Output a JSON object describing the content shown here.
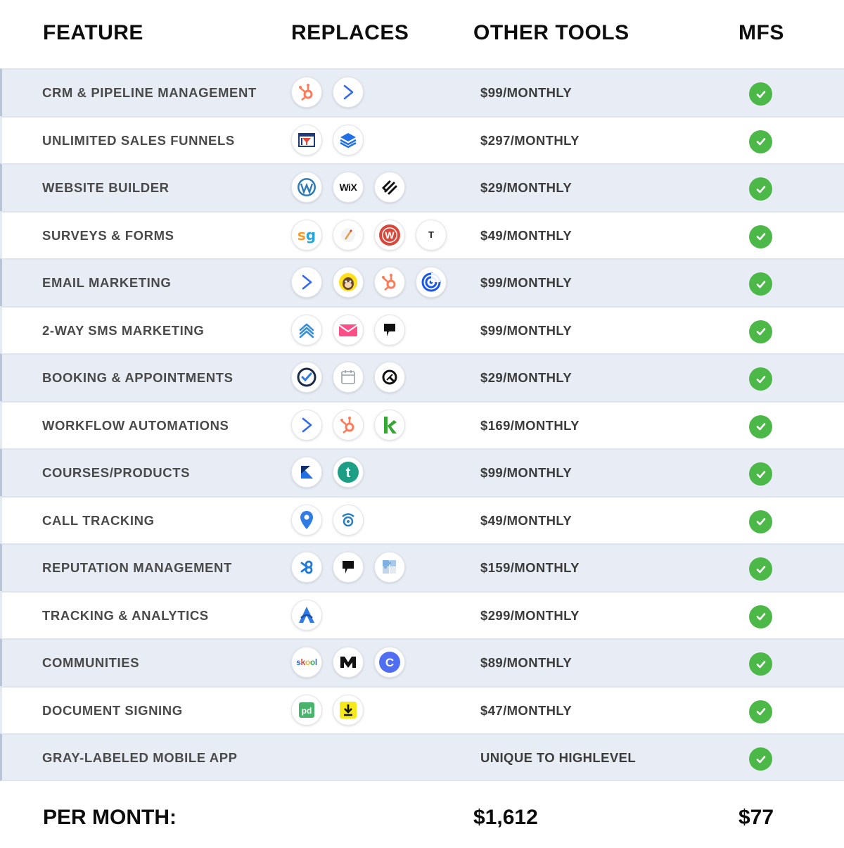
{
  "header": {
    "feature": "FEATURE",
    "replaces": "REPLACES",
    "other_tools": "OTHER TOOLS",
    "mfs": "MFS"
  },
  "colors": {
    "row_shade": "#e7ecf5",
    "check_green": "#4cb848",
    "hubspot_orange": "#ff7a59"
  },
  "rows": [
    {
      "feature": "CRM & PIPELINE MANAGEMENT",
      "price": "$99/MONTHLY",
      "icons": [
        "hubspot-icon",
        "activecampaign-icon"
      ],
      "mfs": "check-icon"
    },
    {
      "feature": "UNLIMITED SALES FUNNELS",
      "price": "$297/MONTHLY",
      "icons": [
        "clickfunnels-icon",
        "layers-icon"
      ],
      "mfs": "check-icon"
    },
    {
      "feature": "WEBSITE BUILDER",
      "price": "$29/MONTHLY",
      "icons": [
        "wordpress-icon",
        "wix-icon",
        "squarespace-icon"
      ],
      "mfs": "check-icon"
    },
    {
      "feature": "SURVEYS & FORMS",
      "price": "$49/MONTHLY",
      "icons": [
        "surveygizmo-icon",
        "pencil-icon",
        "wufoo-icon",
        "typeform-icon"
      ],
      "mfs": "check-icon"
    },
    {
      "feature": "EMAIL MARKETING",
      "price": "$99/MONTHLY",
      "icons": [
        "activecampaign-icon",
        "mailchimp-icon",
        "hubspot-icon",
        "constantcontact-icon"
      ],
      "mfs": "check-icon"
    },
    {
      "feature": "2-WAY SMS MARKETING",
      "price": "$99/MONTHLY",
      "icons": [
        "wave-icon",
        "envelope-icon",
        "podium-icon"
      ],
      "mfs": "check-icon"
    },
    {
      "feature": "BOOKING & APPOINTMENTS",
      "price": "$29/MONTHLY",
      "icons": [
        "calendly-icon",
        "calendar-icon",
        "acuity-icon"
      ],
      "mfs": "check-icon"
    },
    {
      "feature": "WORKFLOW AUTOMATIONS",
      "price": "$169/MONTHLY",
      "icons": [
        "activecampaign-icon",
        "hubspot-icon",
        "keap-icon"
      ],
      "mfs": "check-icon"
    },
    {
      "feature": "COURSES/PRODUCTS",
      "price": "$99/MONTHLY",
      "icons": [
        "kajabi-icon",
        "teachable-icon"
      ],
      "mfs": "check-icon"
    },
    {
      "feature": "CALL TRACKING",
      "price": "$49/MONTHLY",
      "icons": [
        "location-pin-icon",
        "callrail-icon"
      ],
      "mfs": "check-icon"
    },
    {
      "feature": "REPUTATION MANAGEMENT",
      "price": "$159/MONTHLY",
      "icons": [
        "birdeye-icon",
        "podium-icon",
        "puzzle-icon"
      ],
      "mfs": "check-icon"
    },
    {
      "feature": "TRACKING & ANALYTICS",
      "price": "$299/MONTHLY",
      "icons": [
        "analytics-icon"
      ],
      "mfs": "check-icon"
    },
    {
      "feature": "COMMUNITIES",
      "price": "$89/MONTHLY",
      "icons": [
        "skool-icon",
        "mighty-icon",
        "circle-icon"
      ],
      "mfs": "check-icon"
    },
    {
      "feature": "DOCUMENT SIGNING",
      "price": "$47/MONTHLY",
      "icons": [
        "pandadoc-icon",
        "download-icon"
      ],
      "mfs": "check-icon"
    },
    {
      "feature": "GRAY-LABELED MOBILE APP",
      "price": "UNIQUE TO HIGHLEVEL",
      "icons": [],
      "mfs": "check-icon"
    }
  ],
  "footer": {
    "label": "PER MONTH:",
    "other_total": "$1,612",
    "mfs_total": "$77"
  },
  "icon_text": {
    "wix": "WiX",
    "surveygizmo": "sg",
    "skool": "skool",
    "teachable": "t",
    "circle": "C",
    "pandadoc": "pd",
    "typeform": "T"
  }
}
